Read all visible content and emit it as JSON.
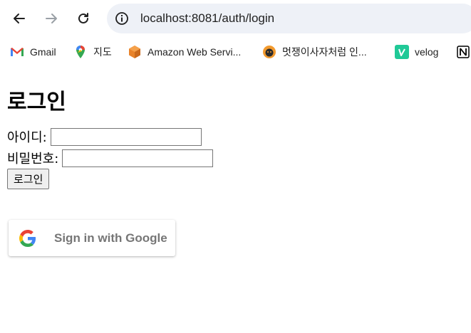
{
  "browser": {
    "url": "localhost:8081/auth/login"
  },
  "bookmarks": [
    {
      "label": "Gmail",
      "icon": "gmail-icon"
    },
    {
      "label": "지도",
      "icon": "maps-icon"
    },
    {
      "label": "Amazon Web Servi...",
      "icon": "aws-icon"
    },
    {
      "label": "멋쟁이사자처럼 인...",
      "icon": "lion-icon"
    },
    {
      "label": "velog",
      "icon": "velog-icon"
    },
    {
      "label": "",
      "icon": "notion-icon"
    }
  ],
  "page": {
    "title": "로그인",
    "id_label": "아이디:",
    "id_value": "",
    "password_label": "비밀번호:",
    "password_value": "",
    "login_button": "로그인",
    "google_button": "Sign in with Google"
  },
  "colors": {
    "omnibox": "#eef1f7",
    "google_blue": "#4285F4",
    "google_red": "#EA4335",
    "google_yellow": "#FBBC05",
    "google_green": "#34A853"
  }
}
